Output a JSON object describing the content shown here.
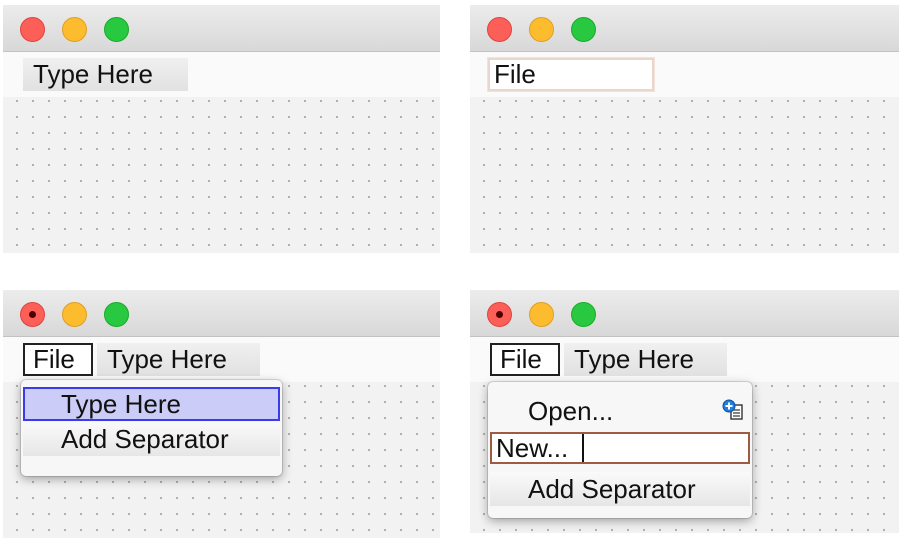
{
  "panel1": {
    "menubar": {
      "placeholder": "Type Here"
    }
  },
  "panel2": {
    "menubar": {
      "editing_value": "File"
    }
  },
  "panel3": {
    "menubar": {
      "menu": "File",
      "placeholder": "Type Here"
    },
    "dropdown": {
      "items": [
        "Type Here",
        "Add Separator"
      ]
    }
  },
  "panel4": {
    "menubar": {
      "menu": "File",
      "placeholder": "Type Here"
    },
    "dropdown": {
      "items": [
        "Open...",
        "New...",
        "Add Separator"
      ]
    },
    "icons": [
      "add-submenu-icon"
    ]
  },
  "window_controls": [
    "close",
    "minimize",
    "zoom"
  ],
  "colors": {
    "close": "#fc5f57",
    "minimize": "#fdbc2e",
    "zoom": "#28c840",
    "selection": "#ccccf8",
    "selection_border": "#3a3aee",
    "canvas": "#f2f2f2"
  }
}
